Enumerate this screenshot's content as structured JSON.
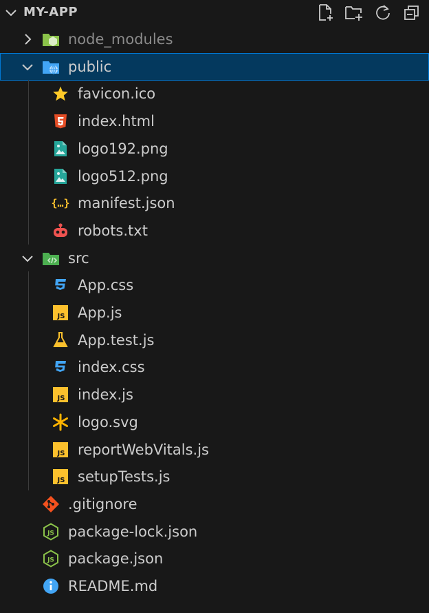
{
  "explorer": {
    "title": "MY-APP",
    "actions": [
      {
        "name": "new-file-icon"
      },
      {
        "name": "new-folder-icon"
      },
      {
        "name": "refresh-icon"
      },
      {
        "name": "collapse-all-icon"
      }
    ]
  },
  "tree": [
    {
      "label": "node_modules",
      "icon": "node-folder-icon",
      "depth": 0,
      "type": "folder",
      "expanded": false
    },
    {
      "label": "public",
      "icon": "public-folder-icon",
      "depth": 0,
      "type": "folder",
      "expanded": true,
      "selected": true
    },
    {
      "label": "favicon.ico",
      "icon": "star-icon",
      "depth": 1,
      "type": "file"
    },
    {
      "label": "index.html",
      "icon": "html5-icon",
      "depth": 1,
      "type": "file"
    },
    {
      "label": "logo192.png",
      "icon": "image-icon",
      "depth": 1,
      "type": "file"
    },
    {
      "label": "logo512.png",
      "icon": "image-icon",
      "depth": 1,
      "type": "file"
    },
    {
      "label": "manifest.json",
      "icon": "json-braces-icon",
      "depth": 1,
      "type": "file"
    },
    {
      "label": "robots.txt",
      "icon": "robot-icon",
      "depth": 1,
      "type": "file"
    },
    {
      "label": "src",
      "icon": "src-folder-icon",
      "depth": 0,
      "type": "folder",
      "expanded": true
    },
    {
      "label": "App.css",
      "icon": "css3-icon",
      "depth": 1,
      "type": "file"
    },
    {
      "label": "App.js",
      "icon": "js-icon",
      "depth": 1,
      "type": "file"
    },
    {
      "label": "App.test.js",
      "icon": "flask-icon",
      "depth": 1,
      "type": "file"
    },
    {
      "label": "index.css",
      "icon": "css3-icon",
      "depth": 1,
      "type": "file"
    },
    {
      "label": "index.js",
      "icon": "js-icon",
      "depth": 1,
      "type": "file"
    },
    {
      "label": "logo.svg",
      "icon": "svg-asterisk-icon",
      "depth": 1,
      "type": "file"
    },
    {
      "label": "reportWebVitals.js",
      "icon": "js-icon",
      "depth": 1,
      "type": "file"
    },
    {
      "label": "setupTests.js",
      "icon": "js-icon",
      "depth": 1,
      "type": "file"
    },
    {
      "label": ".gitignore",
      "icon": "git-icon",
      "depth": 0,
      "type": "file"
    },
    {
      "label": "package-lock.json",
      "icon": "nodejs-icon",
      "depth": 0,
      "type": "file"
    },
    {
      "label": "package.json",
      "icon": "nodejs-icon",
      "depth": 0,
      "type": "file"
    },
    {
      "label": "README.md",
      "icon": "info-icon",
      "depth": 0,
      "type": "file"
    }
  ],
  "colors": {
    "background": "#181818",
    "selected_background": "#04395e",
    "selected_border": "#0078d4",
    "text": "#cccccc",
    "dimmed_text": "#8b8b8b"
  }
}
